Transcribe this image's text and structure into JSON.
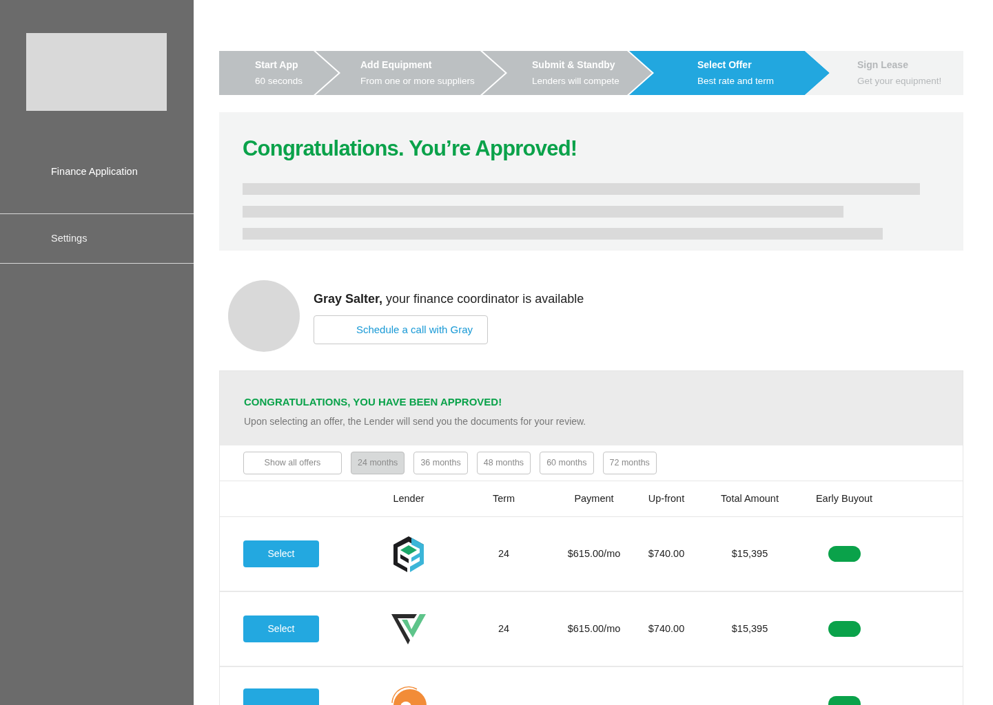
{
  "sidebar": {
    "items": [
      {
        "label": "Finance Application",
        "selected": true
      },
      {
        "label": "Settings",
        "selected": false
      }
    ]
  },
  "steps": [
    {
      "title": "Start App",
      "subtitle": "60 seconds",
      "completed": true,
      "selected": false
    },
    {
      "title": "Add Equipment",
      "subtitle": "From one or more suppliers",
      "completed": true,
      "selected": false
    },
    {
      "title": "Submit & Standby",
      "subtitle": "Lenders will compete",
      "completed": true,
      "selected": false
    },
    {
      "title": "Select Offer",
      "subtitle": "Best rate and term",
      "completed": false,
      "selected": true
    },
    {
      "title": "Sign Lease",
      "subtitle": "Get your equipment!",
      "completed": false,
      "selected": false
    }
  ],
  "approval": {
    "title": "Congratulations. You’re Approved!"
  },
  "coordinator": {
    "message": "**Gray Salter,** your finance coordinator is available",
    "button": "Schedule a call with Gray"
  },
  "offers": {
    "heading": "CONGRATULATIONS, YOU HAVE BEEN APPROVED!",
    "note": "Upon selecting an offer, the Lender will send you the documents for your review.",
    "filters": [
      {
        "label": "Show all offers",
        "selected": false
      },
      {
        "label": "24 months",
        "selected": true
      },
      {
        "label": "36 months",
        "selected": false
      },
      {
        "label": "48 months",
        "selected": false
      },
      {
        "label": "60 months",
        "selected": false
      },
      {
        "label": "72 months",
        "selected": false
      }
    ],
    "columns": [
      "Lender",
      "Term",
      "Payment",
      "Up-front",
      "Total Amount",
      "Early Buyout"
    ],
    "rows": [
      {
        "button": "Select",
        "term": "24",
        "payment": "$615.00/mo",
        "upfront": "$740.00",
        "total": "$15,395",
        "early_buyout": true
      },
      {
        "button": "Select",
        "term": "24",
        "payment": "$615.00/mo",
        "upfront": "$740.00",
        "total": "$15,395",
        "early_buyout": true
      },
      {
        "early_buyout": true
      }
    ]
  }
}
